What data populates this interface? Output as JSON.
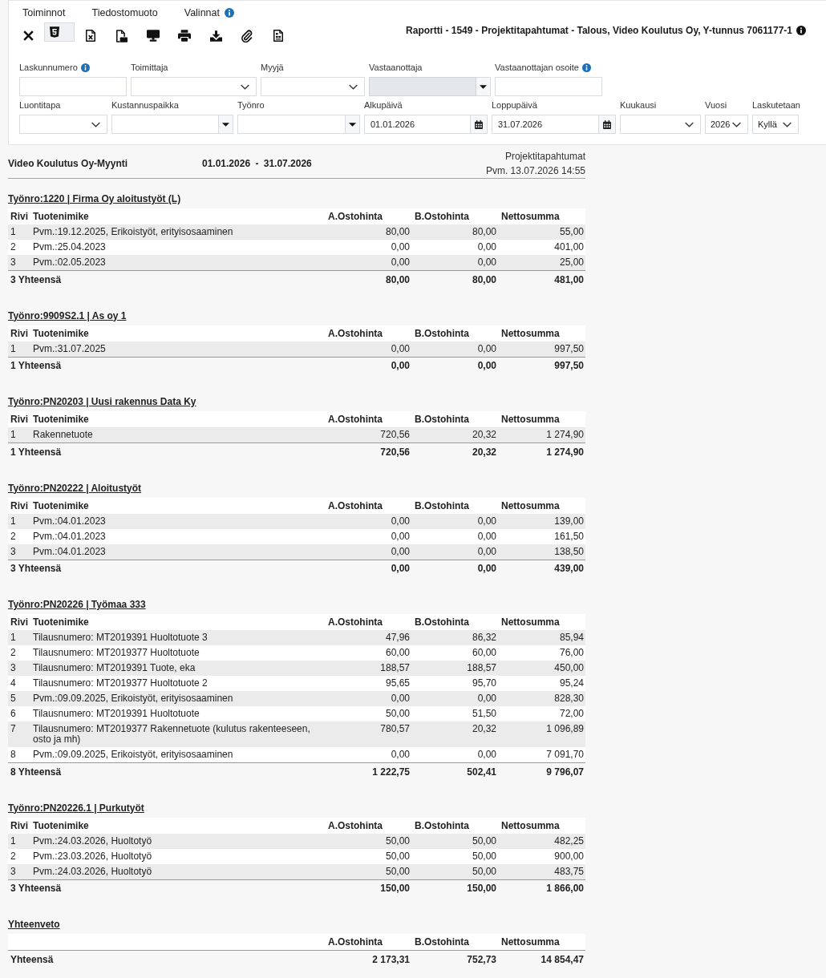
{
  "menu": [
    {
      "label": "Toiminnot",
      "info": false
    },
    {
      "label": "Tiedostomuoto",
      "info": false
    },
    {
      "label": "Valinnat",
      "info": true
    }
  ],
  "toolbar": [
    {
      "kind": "close",
      "selected": false
    },
    {
      "kind": "html",
      "selected": true
    },
    {
      "kind": "excel",
      "selected": false
    },
    {
      "kind": "pdf",
      "selected": false
    },
    {
      "kind": "screen",
      "selected": false
    },
    {
      "kind": "print",
      "selected": false
    },
    {
      "kind": "download",
      "selected": false
    },
    {
      "kind": "attach",
      "selected": false
    },
    {
      "kind": "document",
      "selected": false
    }
  ],
  "report_title": "Raportti - 1549 - Projektitapahtumat - Talous, Video Koulutus Oy, Y-tunnus 7061177-1",
  "filters": [
    [
      {
        "label": "Laskunnumero",
        "info": true,
        "kind": "text",
        "disabled": false
      },
      {
        "label": "Toimittaja",
        "info": false,
        "kind": "select",
        "disabled": false
      },
      {
        "label": "Myyjä",
        "info": false,
        "kind": "select",
        "disabled": false
      },
      {
        "label": "Vastaanottaja",
        "info": false,
        "kind": "combo",
        "disabled": true
      },
      {
        "label": "Vastaanottajan osoite",
        "info": true,
        "kind": "text",
        "disabled": false
      }
    ],
    [
      {
        "label": "Luontitapa",
        "info": false,
        "kind": "select",
        "disabled": false
      },
      {
        "label": "Kustannuspaikka",
        "info": false,
        "kind": "combo",
        "disabled": false
      },
      {
        "label": "Työnro",
        "info": false,
        "kind": "combo",
        "disabled": false
      },
      {
        "label": "Alkupäivä",
        "info": false,
        "kind": "date",
        "disabled": false,
        "value": "01.01.2026"
      },
      {
        "label": "Loppupäivä",
        "info": false,
        "kind": "date",
        "disabled": false,
        "value": "31.07.2026"
      },
      {
        "label": "Kuukausi",
        "info": false,
        "kind": "select",
        "disabled": false
      },
      {
        "label": "Vuosi",
        "info": false,
        "kind": "select",
        "disabled": false,
        "value": "2026"
      },
      {
        "label": "Laskutetaan",
        "info": false,
        "kind": "select",
        "disabled": false,
        "value": "Kyllä"
      }
    ]
  ],
  "report": {
    "company": "Video Koulutus Oy-Myynti",
    "period": "01.01.2026 - 31.07.2026",
    "report_name": "Projektitapahtumat",
    "printed": "Pvm. 13.07.2026 14:55",
    "groups": [
      {
        "title": "Työnro:1220 | Firma Oy aloitustyöt (L)",
        "columns": [
          "Rivi",
          "Tuotenimike",
          "A.Ostohinta",
          "B.Ostohinta",
          "Nettosumma"
        ],
        "rows": [
          [
            "1",
            "Pvm.:19.12.2025, Erikoistyöt, erityisosaaminen",
            "80,00",
            "80,00",
            "55,00"
          ],
          [
            "2",
            "Pvm.:25.04.2023",
            "0,00",
            "0,00",
            "401,00"
          ],
          [
            "3",
            "Pvm.:02.05.2023",
            "0,00",
            "0,00",
            "25,00"
          ]
        ],
        "total": [
          "3 Yhteensä",
          "80,00",
          "80,00",
          "481,00"
        ]
      },
      {
        "title": "Työnro:9909S2.1 | As oy 1",
        "columns": [
          "Rivi",
          "Tuotenimike",
          "A.Ostohinta",
          "B.Ostohinta",
          "Nettosumma"
        ],
        "rows": [
          [
            "1",
            "Pvm.:31.07.2025",
            "0,00",
            "0,00",
            "997,50"
          ]
        ],
        "total": [
          "1 Yhteensä",
          "0,00",
          "0,00",
          "997,50"
        ]
      },
      {
        "title": "Työnro:PN20203 | Uusi rakennus Data Ky",
        "columns": [
          "Rivi",
          "Tuotenimike",
          "A.Ostohinta",
          "B.Ostohinta",
          "Nettosumma"
        ],
        "rows": [
          [
            "1",
            "Rakennetuote",
            "720,56",
            "20,32",
            "1 274,90"
          ]
        ],
        "total": [
          "1 Yhteensä",
          "720,56",
          "20,32",
          "1 274,90"
        ]
      },
      {
        "title": "Työnro:PN20222 | Aloitustyöt",
        "columns": [
          "Rivi",
          "Tuotenimike",
          "A.Ostohinta",
          "B.Ostohinta",
          "Nettosumma"
        ],
        "rows": [
          [
            "1",
            "Pvm.:04.01.2023",
            "0,00",
            "0,00",
            "139,00"
          ],
          [
            "2",
            "Pvm.:04.01.2023",
            "0,00",
            "0,00",
            "161,50"
          ],
          [
            "3",
            "Pvm.:04.01.2023",
            "0,00",
            "0,00",
            "138,50"
          ]
        ],
        "total": [
          "3 Yhteensä",
          "0,00",
          "0,00",
          "439,00"
        ]
      },
      {
        "title": "Työnro:PN20226 | Työmaa 333",
        "columns": [
          "Rivi",
          "Tuotenimike",
          "A.Ostohinta",
          "B.Ostohinta",
          "Nettosumma"
        ],
        "rows": [
          [
            "1",
            "Tilausnumero: MT2019391 Huoltotuote 3",
            "47,96",
            "86,32",
            "85,94"
          ],
          [
            "2",
            "Tilausnumero: MT2019377 Huoltotuote",
            "60,00",
            "60,00",
            "76,00"
          ],
          [
            "3",
            "Tilausnumero: MT2019391 Tuote, eka",
            "188,57",
            "188,57",
            "450,00"
          ],
          [
            "4",
            "Tilausnumero: MT2019377 Huoltotuote 2",
            "95,65",
            "95,70",
            "95,24"
          ],
          [
            "5",
            "Pvm.:09.09.2025, Erikoistyöt, erityisosaaminen",
            "0,00",
            "0,00",
            "828,30"
          ],
          [
            "6",
            "Tilausnumero: MT2019391 Huoltotuote",
            "50,00",
            "51,50",
            "72,00"
          ],
          [
            "7",
            "Tilausnumero: MT2019377 Rakennetuote (kulutus rakenteeseen, osto ja mh)",
            "780,57",
            "20,32",
            "1 096,89"
          ],
          [
            "8",
            "Pvm.:09.09.2025, Erikoistyöt, erityisosaaminen",
            "0,00",
            "0,00",
            "7 091,70"
          ]
        ],
        "total": [
          "8 Yhteensä",
          "1 222,75",
          "502,41",
          "9 796,07"
        ]
      },
      {
        "title": "Työnro:PN20226.1 | Purkutyöt",
        "columns": [
          "Rivi",
          "Tuotenimike",
          "A.Ostohinta",
          "B.Ostohinta",
          "Nettosumma"
        ],
        "rows": [
          [
            "1",
            "Pvm.:24.03.2026, Huoltotyö",
            "50,00",
            "50,00",
            "482,25"
          ],
          [
            "2",
            "Pvm.:23.03.2026, Huoltotyö",
            "50,00",
            "50,00",
            "900,00"
          ],
          [
            "3",
            "Pvm.:24.03.2026, Huoltotyö",
            "50,00",
            "50,00",
            "483,75"
          ]
        ],
        "total": [
          "3 Yhteensä",
          "150,00",
          "150,00",
          "1 866,00"
        ]
      }
    ],
    "summary": {
      "title": "Yhteenveto",
      "columns": [
        "A.Ostohinta",
        "B.Ostohinta",
        "Nettosumma"
      ],
      "total": [
        "Yhteensä",
        "2 173,31",
        "752,73",
        "14 854,47"
      ]
    }
  }
}
